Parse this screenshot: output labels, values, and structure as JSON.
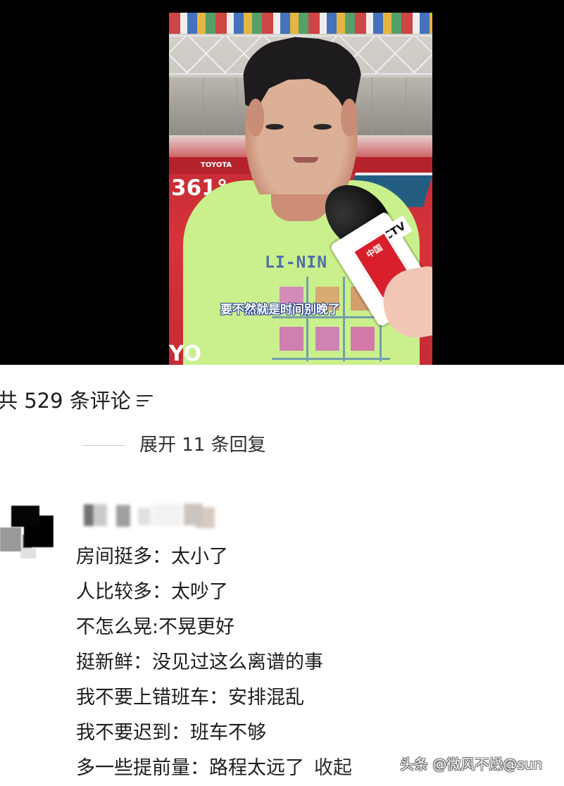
{
  "video": {
    "caption": "要不然就是时间别晚了",
    "arena_brand": "361°",
    "sponsor": "TOYOTA",
    "mic_logo": "CCTV",
    "mic_label": "中国",
    "shirt_text": "LI-NIN",
    "logo_fragment": "",
    "bottom_logo": "YO"
  },
  "comments": {
    "count_text": "共 529 条评论",
    "sort_icon": "sort-icon",
    "expand_replies": "展开 11 条回复",
    "item": {
      "lines": [
        "房间挺多：太小了",
        "人比较多：太吵了",
        "不怎么晃:不晃更好",
        "挺新鲜：没见过这么离谱的事",
        "我不要上错班车：安排混乱",
        "我不要迟到：班车不够",
        "多一些提前量：路程太远了"
      ],
      "collapse": "收起"
    }
  },
  "watermark": "头条 @微风不燥@sun"
}
